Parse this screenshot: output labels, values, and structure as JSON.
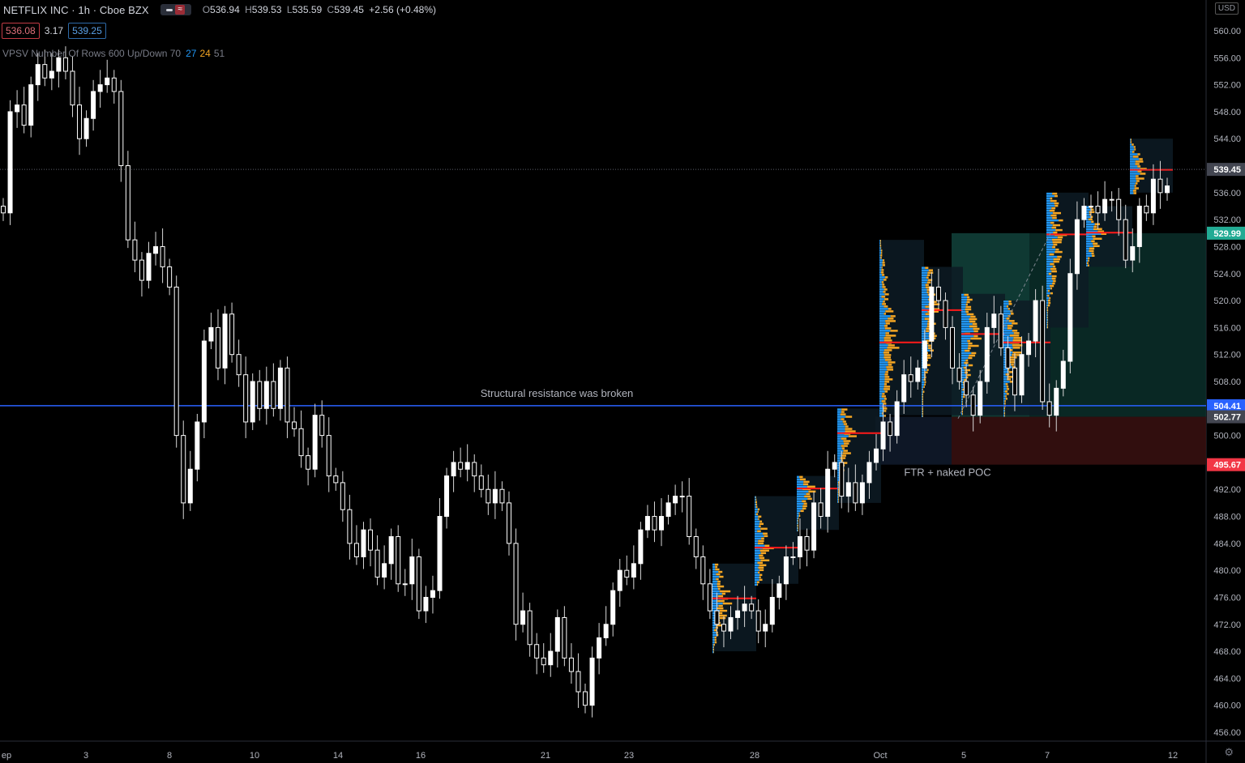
{
  "header": {
    "symbol": "NETFLIX INC · 1h · Cboe BZX",
    "open_label": "O",
    "open": "536.94",
    "high_label": "H",
    "high": "539.53",
    "low_label": "L",
    "low": "535.59",
    "close_label": "C",
    "close": "539.45",
    "change": "+2.56 (+0.48%)",
    "pill_glyph": "≈"
  },
  "trade_box": {
    "sell": "536.08",
    "spread": "3.17",
    "buy": "539.25"
  },
  "indicator": {
    "label": "VPSV Number Of Rows 600 Up/Down 70",
    "v1": "27",
    "v2": "24",
    "v3": "51"
  },
  "currency": "USD",
  "settings_icon": "gear-icon",
  "colors": {
    "background": "#000000",
    "candle": "#ffffff",
    "resistance": "#2962ff",
    "up_volume": "#2196f3",
    "down_volume": "#f5a623",
    "poc": "#ff1a1a",
    "last_price_tag": "#434651",
    "target_tag": "#22ab94",
    "stop_tag": "#f23645"
  },
  "chart_data": {
    "type": "candlestick",
    "y_range": [
      454,
      563
    ],
    "y_ticks": [
      560,
      556,
      552,
      548,
      544,
      536,
      532,
      528,
      524,
      520,
      516,
      512,
      508,
      500,
      492,
      488,
      484,
      480,
      476,
      472,
      468,
      464,
      460,
      456
    ],
    "y_tick_labels": [
      "560.00",
      "556.00",
      "552.00",
      "548.00",
      "544.00",
      "536.00",
      "532.00",
      "528.00",
      "524.00",
      "520.00",
      "516.00",
      "512.00",
      "508.00",
      "500.00",
      "492.00",
      "488.00",
      "484.00",
      "480.00",
      "476.00",
      "472.00",
      "468.00",
      "464.00",
      "460.00",
      "456.00"
    ],
    "x_labels": [
      "ep",
      "3",
      "8",
      "10",
      "14",
      "16",
      "21",
      "23",
      "28",
      "Oct",
      "5",
      "7",
      "12"
    ],
    "price_tags": [
      {
        "value": 539.45,
        "label": "539.45",
        "kind": "last"
      },
      {
        "value": 529.99,
        "label": "529.99",
        "kind": "target"
      },
      {
        "value": 504.41,
        "label": "504.41",
        "kind": "resistance"
      },
      {
        "value": 502.77,
        "label": "502.77",
        "kind": "entry"
      },
      {
        "value": 495.67,
        "label": "495.67",
        "kind": "stop"
      }
    ],
    "resistance_level": 504.41,
    "annotations": [
      "Structural resistance was broken",
      "FTR + naked POC"
    ],
    "closes": [
      533,
      548,
      549,
      546,
      552,
      555,
      553,
      554,
      556,
      554,
      549,
      544,
      547,
      551,
      552,
      553,
      551,
      540,
      529,
      526,
      523,
      527,
      528,
      525,
      522,
      500,
      490,
      495,
      502,
      514,
      516,
      510,
      518,
      512,
      509,
      502,
      508,
      504,
      508,
      504,
      510,
      502,
      501,
      497,
      495,
      503,
      500,
      494,
      493,
      489,
      484,
      482,
      486,
      483,
      479,
      481,
      485,
      478,
      478,
      482,
      474,
      476,
      477,
      488,
      494,
      496,
      495,
      496,
      494,
      492,
      490,
      492,
      490,
      484,
      472,
      474,
      469,
      467,
      466,
      468,
      473,
      467,
      465,
      462,
      460,
      467,
      470,
      472,
      477,
      480,
      479,
      481,
      486,
      488,
      486,
      488,
      490,
      491,
      491,
      485,
      482,
      478,
      474,
      472,
      471,
      473,
      474,
      475,
      474,
      471,
      472,
      476,
      478,
      482,
      482,
      485,
      483,
      490,
      488,
      495,
      496,
      491,
      493,
      490,
      493,
      496,
      498,
      502,
      500,
      505,
      509,
      508,
      510,
      514,
      522,
      520,
      516,
      510,
      508,
      506,
      503,
      508,
      516,
      518,
      513,
      510,
      506,
      512,
      514,
      520,
      505,
      503,
      507,
      511,
      524,
      532,
      534,
      534,
      533,
      535,
      535,
      532,
      526,
      528,
      534,
      533,
      538,
      536,
      537
    ]
  }
}
